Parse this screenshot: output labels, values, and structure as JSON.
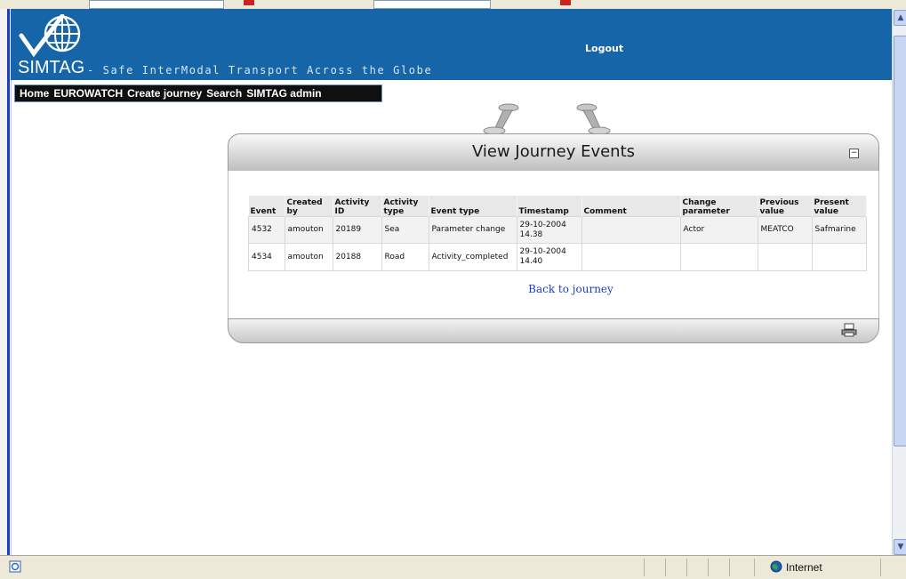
{
  "header": {
    "brand": "SIMTAG",
    "tagline": "- Safe InterModal Transport Across the Globe",
    "logout": "Logout"
  },
  "nav": {
    "items": [
      "Home",
      "EUROWATCH",
      "Create journey",
      "Search",
      "SIMTAG admin"
    ]
  },
  "panel": {
    "title": "View Journey Events",
    "back_link": "Back to journey"
  },
  "table": {
    "headers": [
      "Event",
      "Created by",
      "Activity ID",
      "Activity type",
      "Event type",
      "Timestamp",
      "Comment",
      "Change parameter",
      "Previous value",
      "Present value"
    ],
    "rows": [
      [
        "4532",
        "amouton",
        "20189",
        "Sea",
        "Parameter change",
        "29-10-2004 14.38",
        "",
        "Actor",
        "MEATCO",
        "Safmarine"
      ],
      [
        "4534",
        "amouton",
        "20188",
        "Road",
        "Activity_completed",
        "29-10-2004 14.40",
        "",
        "",
        "",
        ""
      ]
    ]
  },
  "statusbar": {
    "zone": "Internet"
  },
  "colors": {
    "header_bg": "#1565a8",
    "nav_bg": "#101010",
    "link": "#1a3fbf"
  }
}
